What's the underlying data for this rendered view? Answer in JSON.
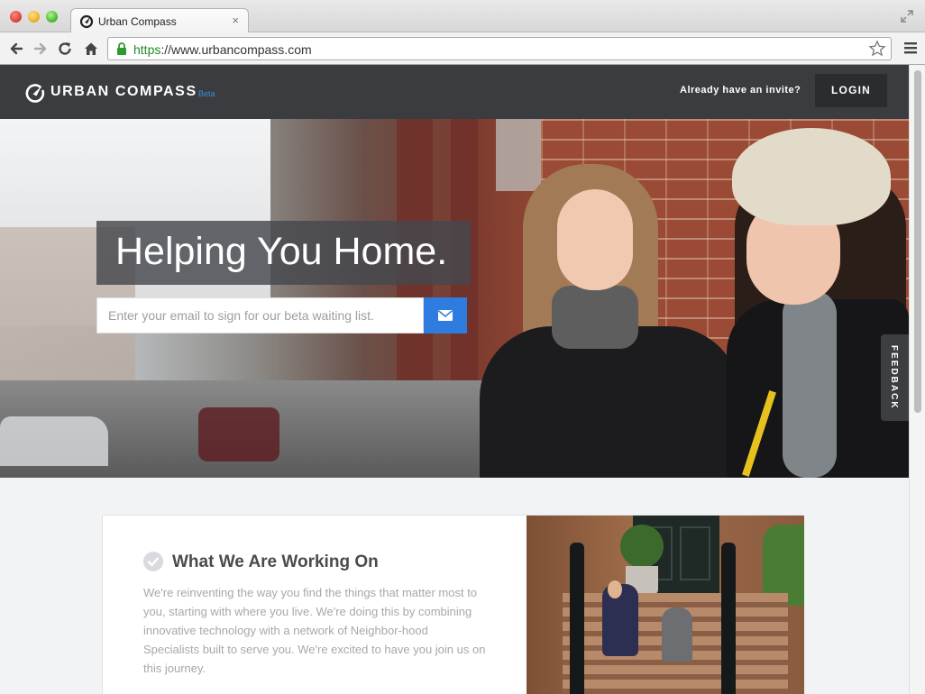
{
  "browser": {
    "tab_title": "Urban Compass",
    "tab_close": "×",
    "url_scheme": "https",
    "url_rest": "://www.urbancompass.com"
  },
  "header": {
    "logo_text": "URBAN COMPASS",
    "logo_badge": "Beta",
    "invite_text": "Already have an invite?",
    "login_label": "LOGIN"
  },
  "hero": {
    "headline": "Helping You Home.",
    "email_placeholder": "Enter your email to sign for our beta waiting list.",
    "feedback_label": "FEEDBACK"
  },
  "card": {
    "title": "What We Are Working On",
    "body": "We're reinventing the way you find the things that matter most to you, starting with where you live. We're doing this by combining innovative technology with a network of Neighbor-hood Specialists built to serve you. We're excited to have you join us on this journey."
  },
  "colors": {
    "header_bg": "#3b3c40",
    "accent_blue": "#2f7ce0",
    "beta_blue": "#3a8dde",
    "url_green": "#1f8a2b"
  },
  "icons": [
    "back-icon",
    "forward-icon",
    "reload-icon",
    "home-icon",
    "lock-icon",
    "star-icon",
    "menu-icon",
    "compass-logo-icon",
    "mail-icon",
    "check-icon"
  ]
}
